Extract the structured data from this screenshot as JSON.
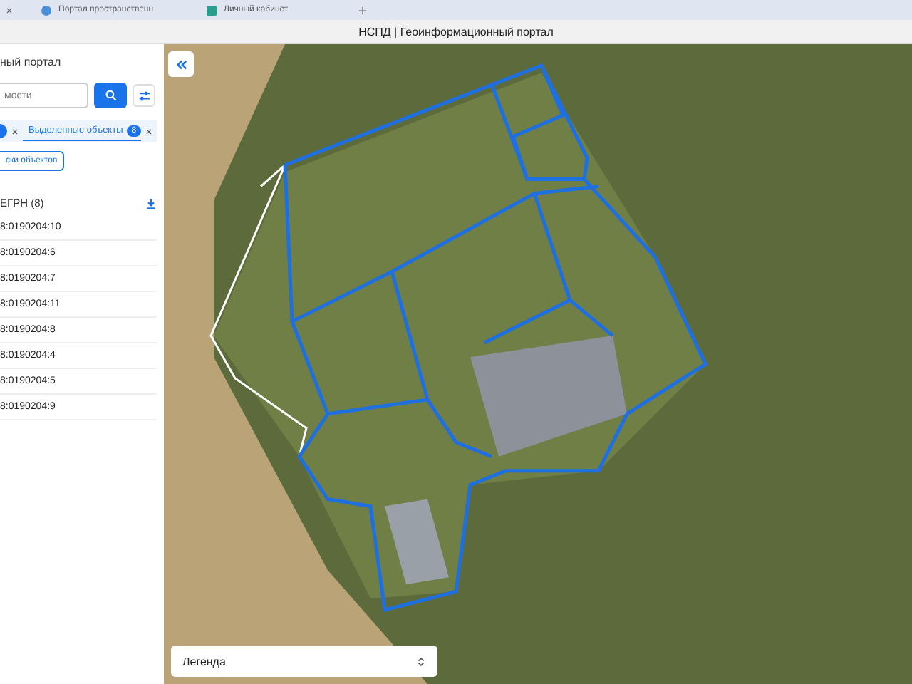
{
  "browser_tabs": [
    {
      "title": "Портал пространственн"
    },
    {
      "title": "Личный кабинет"
    }
  ],
  "page_title": "НСПД | Геоинформационный портал",
  "sidebar": {
    "title": "ный портал",
    "search": {
      "placeholder": "мости"
    },
    "chips": [
      {
        "label": "Выделенные объекты",
        "count": "8"
      }
    ],
    "action_button": "ски объектов",
    "list_title": "ЕГРН (8)",
    "items": [
      "8:0190204:10",
      "8:0190204:6",
      "8:0190204:7",
      "8:0190204:11",
      "8:0190204:8",
      "8:0190204:4",
      "8:0190204:5",
      "8:0190204:9"
    ]
  },
  "map": {
    "legend": "Легенда"
  }
}
